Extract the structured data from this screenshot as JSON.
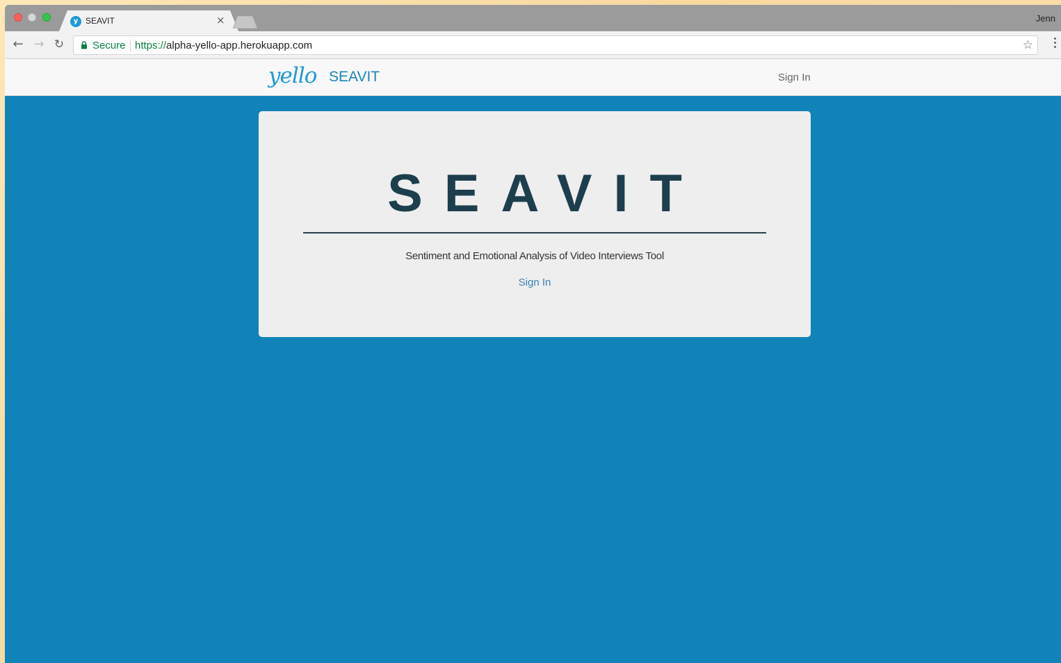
{
  "browser": {
    "tab_title": "SEAVIT",
    "tab_favicon_letter": "y",
    "tab_close": "×",
    "profile_name": "Jenn",
    "secure_label": "Secure",
    "url_scheme": "https://",
    "url_host": "alpha-yello-app.herokuapp.com",
    "icons": [
      "back-arrow-icon",
      "forward-arrow-icon",
      "reload-icon",
      "lock-icon",
      "star-icon",
      "menu-icon"
    ]
  },
  "navbar": {
    "logo_text": "yello",
    "brand_name": "SEAVIT",
    "sign_in_label": "Sign In"
  },
  "hero": {
    "title": "SEAVIT",
    "subtitle": "Sentiment and Emotional Analysis of Video Interviews Tool",
    "sign_in_link": "Sign In"
  },
  "colors": {
    "page_background": "#1084b8",
    "brand_blue": "#1a9ad6",
    "title_color": "#1d3e4c",
    "link_color": "#3b7fb3",
    "secure_green": "#0b8043"
  }
}
